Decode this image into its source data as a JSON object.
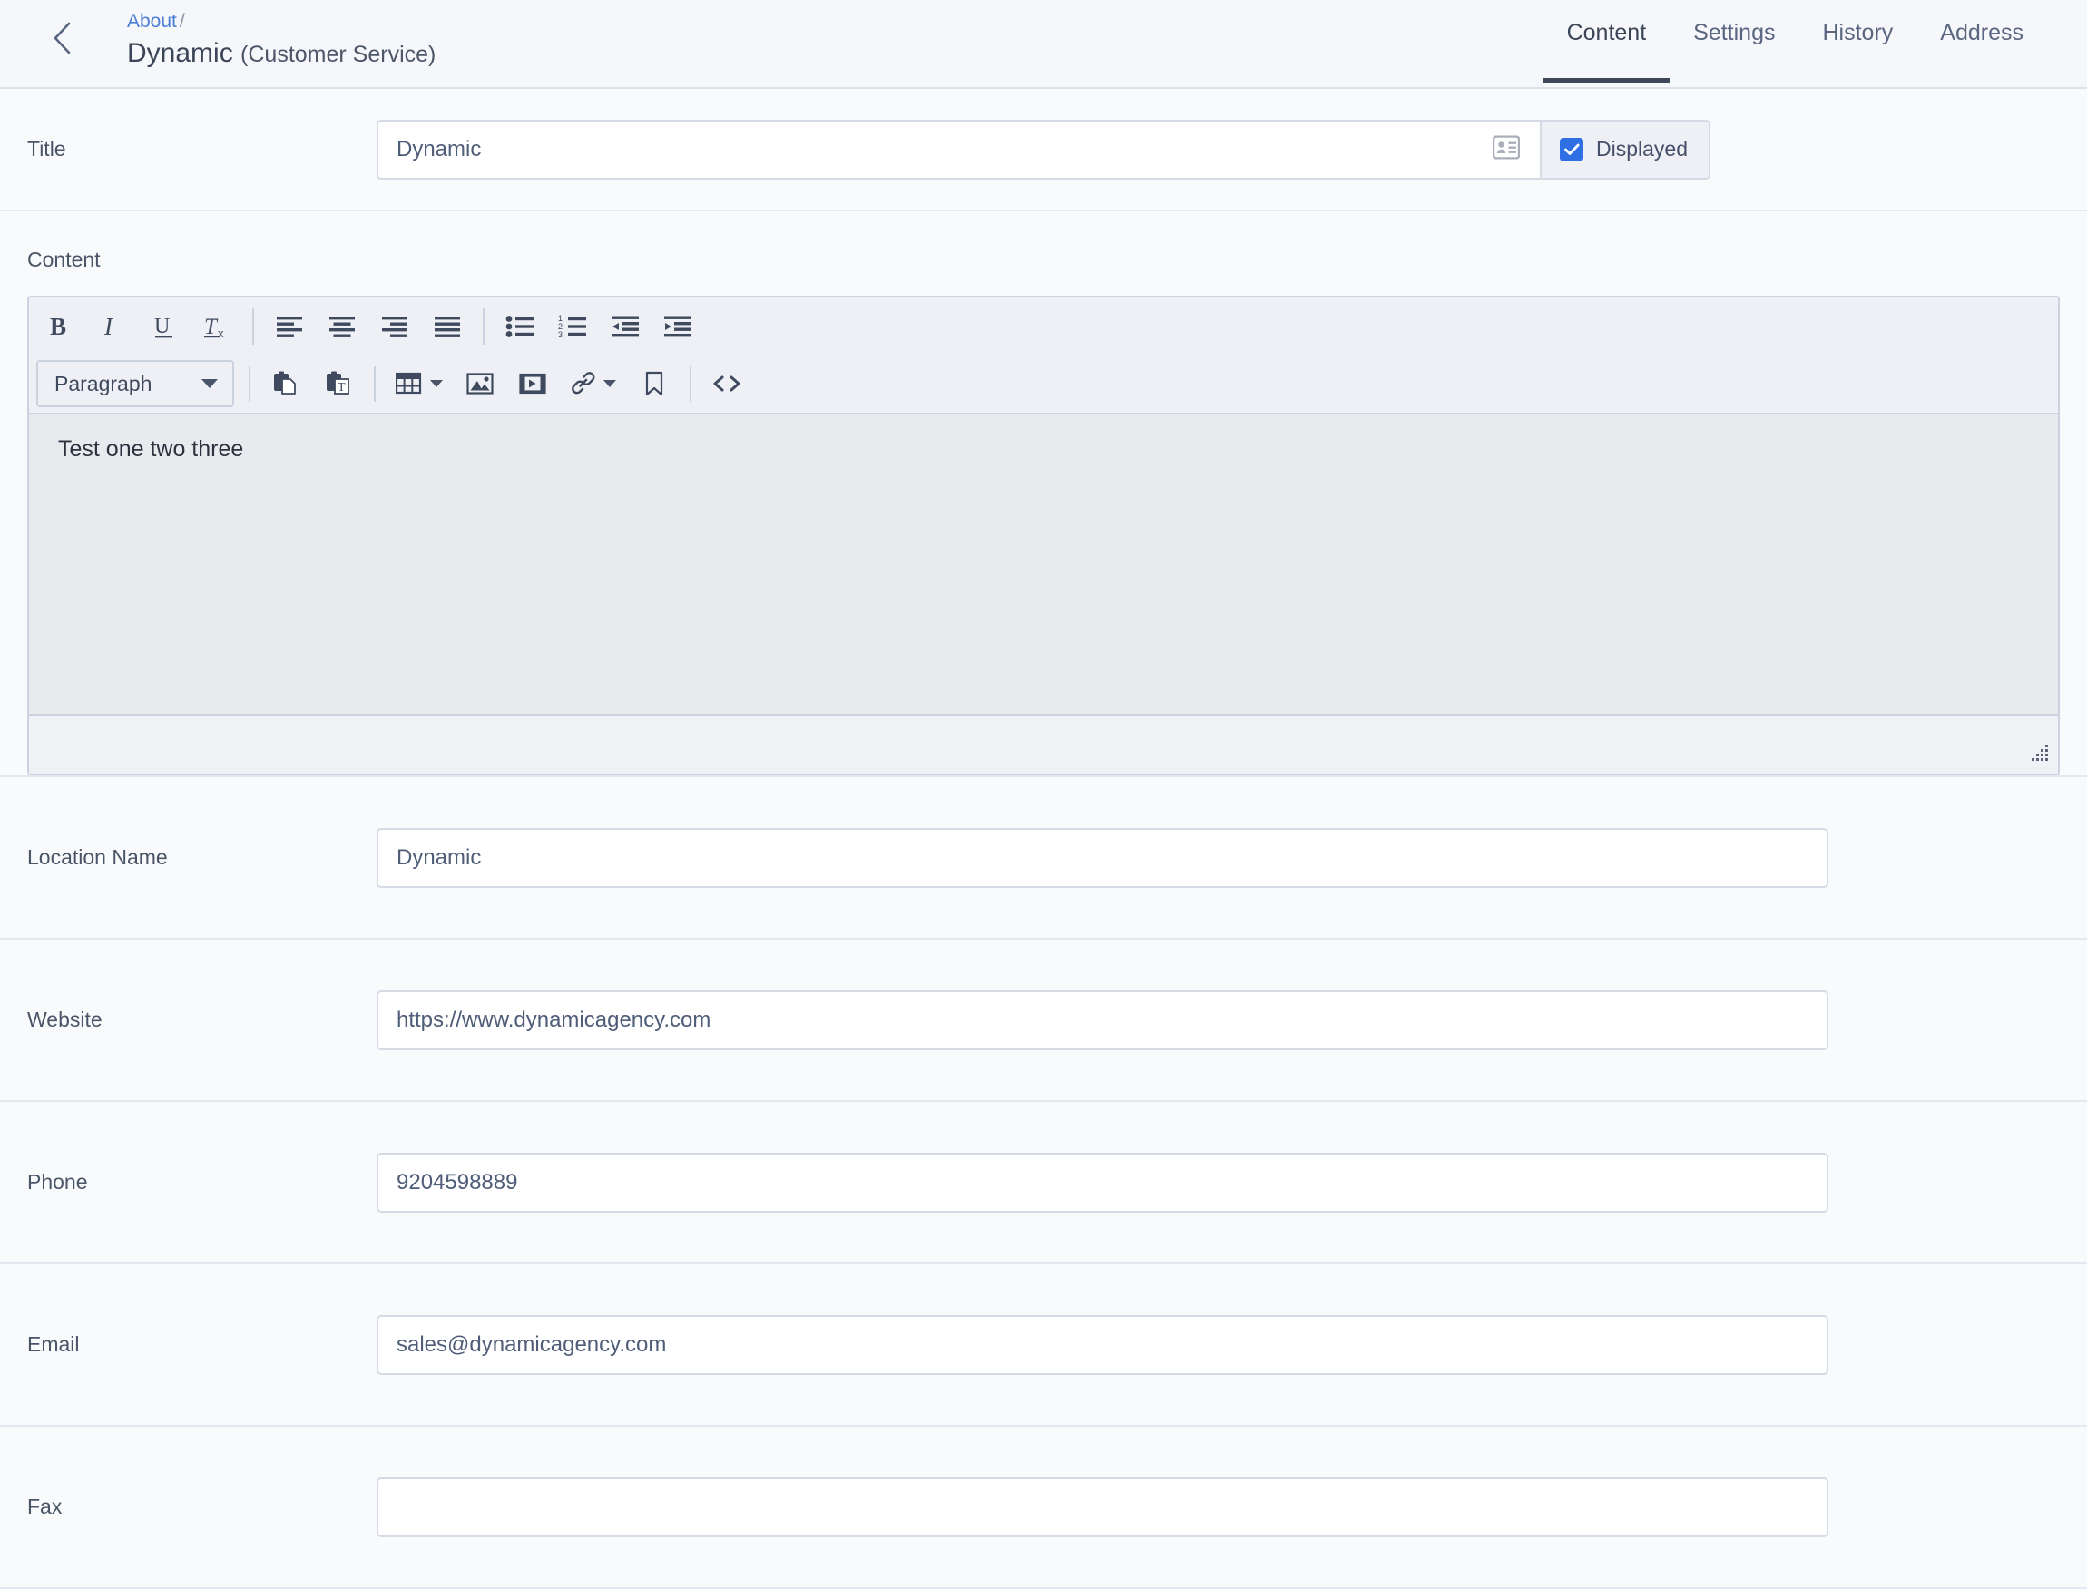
{
  "header": {
    "back_icon": "chevron-left-icon",
    "breadcrumb_parent": "About",
    "breadcrumb_separator": "/",
    "page_title": "Dynamic",
    "page_subtitle": "(Customer Service)",
    "tabs": [
      {
        "label": "Content",
        "active": true
      },
      {
        "label": "Settings",
        "active": false
      },
      {
        "label": "History",
        "active": false
      },
      {
        "label": "Address",
        "active": false
      }
    ]
  },
  "title_row": {
    "label": "Title",
    "value": "Dynamic",
    "placeholder": "",
    "field_icon": "contact-card-icon",
    "displayed_label": "Displayed",
    "displayed_checked": true,
    "checkbox_color": "#2f6fe4"
  },
  "content": {
    "label": "Content",
    "toolbar_row1": [
      {
        "name": "bold-icon",
        "label": "B"
      },
      {
        "name": "italic-icon",
        "label": "I"
      },
      {
        "name": "underline-icon",
        "label": "U"
      },
      {
        "name": "remove-format-icon",
        "label": "Tx"
      },
      {
        "name": "align-left-icon",
        "label": "Align left"
      },
      {
        "name": "align-center-icon",
        "label": "Align center"
      },
      {
        "name": "align-right-icon",
        "label": "Align right"
      },
      {
        "name": "align-justify-icon",
        "label": "Justify"
      },
      {
        "name": "bulleted-list-icon",
        "label": "Bulleted list"
      },
      {
        "name": "numbered-list-icon",
        "label": "Numbered list"
      },
      {
        "name": "outdent-icon",
        "label": "Decrease indent"
      },
      {
        "name": "indent-icon",
        "label": "Increase indent"
      }
    ],
    "paragraph_style": "Paragraph",
    "toolbar_row2": [
      {
        "name": "paste-icon",
        "label": "Paste"
      },
      {
        "name": "paste-as-text-icon",
        "label": "Paste as plain text"
      },
      {
        "name": "table-icon",
        "label": "Table"
      },
      {
        "name": "image-icon",
        "label": "Image"
      },
      {
        "name": "video-icon",
        "label": "Video"
      },
      {
        "name": "link-icon",
        "label": "Link"
      },
      {
        "name": "bookmark-icon",
        "label": "Bookmark"
      },
      {
        "name": "source-code-icon",
        "label": "<>"
      }
    ],
    "body_text": "Test one two three",
    "resize_handle": "resize-grip-icon"
  },
  "fields": [
    {
      "label": "Location Name",
      "value": "Dynamic",
      "placeholder": ""
    },
    {
      "label": "Website",
      "value": "https://www.dynamicagency.com",
      "placeholder": ""
    },
    {
      "label": "Phone",
      "value": "9204598889",
      "placeholder": ""
    },
    {
      "label": "Email",
      "value": "sales@dynamicagency.com",
      "placeholder": ""
    },
    {
      "label": "Fax",
      "value": "",
      "placeholder": ""
    }
  ]
}
